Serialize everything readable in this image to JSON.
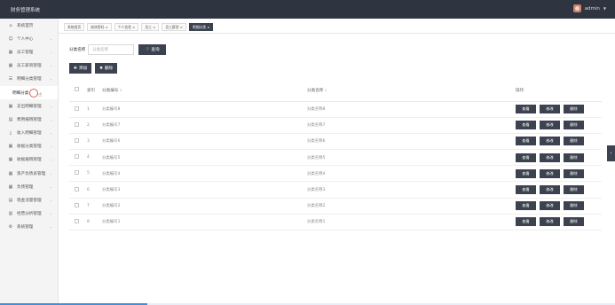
{
  "app": {
    "title": "财务管理系统"
  },
  "user": {
    "name": "admin",
    "caret": "▼"
  },
  "sidebar": {
    "items": [
      {
        "label": "系统首页",
        "icon": "home-icon",
        "glyph": "⌂"
      },
      {
        "label": "个人中心",
        "icon": "user-icon",
        "glyph": "☺"
      },
      {
        "label": "员工管理",
        "icon": "grid-icon",
        "glyph": "▦"
      },
      {
        "label": "员工薪资管理",
        "icon": "grid-icon",
        "glyph": "▦"
      },
      {
        "label": "明细分类管理",
        "icon": "list-icon",
        "glyph": "☰"
      },
      {
        "label": "支出明细管理",
        "icon": "grid-icon",
        "glyph": "▦"
      },
      {
        "label": "费用报销管理",
        "icon": "table-icon",
        "glyph": "▤"
      },
      {
        "label": "收入明细管理",
        "icon": "download-icon",
        "glyph": "⤓"
      },
      {
        "label": "收据分类管理",
        "icon": "grid-icon",
        "glyph": "▦"
      },
      {
        "label": "收据报销管理",
        "icon": "grid-icon",
        "glyph": "▦"
      },
      {
        "label": "资产负债表管理",
        "icon": "grid-icon",
        "glyph": "▦"
      },
      {
        "label": "负债管理",
        "icon": "grid-icon",
        "glyph": "▦"
      },
      {
        "label": "现金流量管理",
        "icon": "table-icon",
        "glyph": "▤"
      },
      {
        "label": "经营分析管理",
        "icon": "chart-icon",
        "glyph": "▥"
      },
      {
        "label": "系统管理",
        "icon": "gear-icon",
        "glyph": "⚙"
      }
    ],
    "active_sub": "明细分类"
  },
  "tabs": [
    "系统首页",
    "修改密码 ×",
    "个人信息 ×",
    "员工 ×",
    "员工薪资 ×",
    "明细分类 ×"
  ],
  "search": {
    "label": "分类名称",
    "placeholder": "分类名称",
    "button": "查询"
  },
  "actions": {
    "add": "添加",
    "delete": "删除"
  },
  "table": {
    "headers": {
      "index": "索引",
      "code": "分类编号",
      "name": "分类名称",
      "ops": "操作"
    },
    "rows": [
      {
        "index": "1",
        "code": "分类编号8",
        "name": "分类名称8"
      },
      {
        "index": "2",
        "code": "分类编号7",
        "name": "分类名称7"
      },
      {
        "index": "3",
        "code": "分类编号6",
        "name": "分类名称6"
      },
      {
        "index": "4",
        "code": "分类编号5",
        "name": "分类名称5"
      },
      {
        "index": "5",
        "code": "分类编号4",
        "name": "分类名称4"
      },
      {
        "index": "6",
        "code": "分类编号3",
        "name": "分类名称3"
      },
      {
        "index": "7",
        "code": "分类编号2",
        "name": "分类名称2"
      },
      {
        "index": "8",
        "code": "分类编号1",
        "name": "分类名称1"
      }
    ],
    "op_labels": {
      "view": "查看",
      "edit": "修改",
      "delete": "删除"
    }
  },
  "colors": {
    "topbar": "#2f3441",
    "button": "#3c4250",
    "accent_ring": "#e25a5a"
  },
  "page_progress": 0.24
}
